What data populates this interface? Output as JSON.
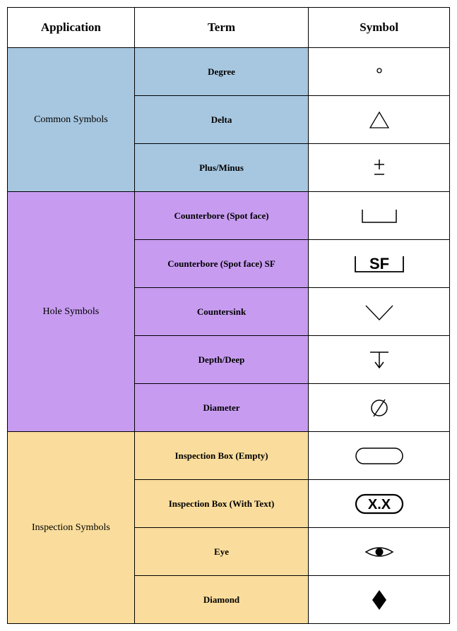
{
  "headers": {
    "application": "Application",
    "term": "Term",
    "symbol": "Symbol"
  },
  "groups": [
    {
      "application": "Common Symbols",
      "bg": "bg-blue",
      "rows": [
        {
          "term": "Degree",
          "symbol": "degree"
        },
        {
          "term": "Delta",
          "symbol": "delta"
        },
        {
          "term": "Plus/Minus",
          "symbol": "plus-minus"
        }
      ]
    },
    {
      "application": "Hole Symbols",
      "bg": "bg-purple",
      "rows": [
        {
          "term": "Counterbore (Spot face)",
          "symbol": "counterbore"
        },
        {
          "term": "Counterbore (Spot face) SF",
          "symbol": "counterbore-sf",
          "text": "SF"
        },
        {
          "term": "Countersink",
          "symbol": "countersink"
        },
        {
          "term": "Depth/Deep",
          "symbol": "depth"
        },
        {
          "term": "Diameter",
          "symbol": "diameter"
        }
      ]
    },
    {
      "application": "Inspection Symbols",
      "bg": "bg-peach",
      "rows": [
        {
          "term": "Inspection Box (Empty)",
          "symbol": "inspection-empty"
        },
        {
          "term": "Inspection Box (With Text)",
          "symbol": "inspection-text",
          "text": "X.X"
        },
        {
          "term": "Eye",
          "symbol": "eye"
        },
        {
          "term": "Diamond",
          "symbol": "diamond"
        }
      ]
    }
  ]
}
